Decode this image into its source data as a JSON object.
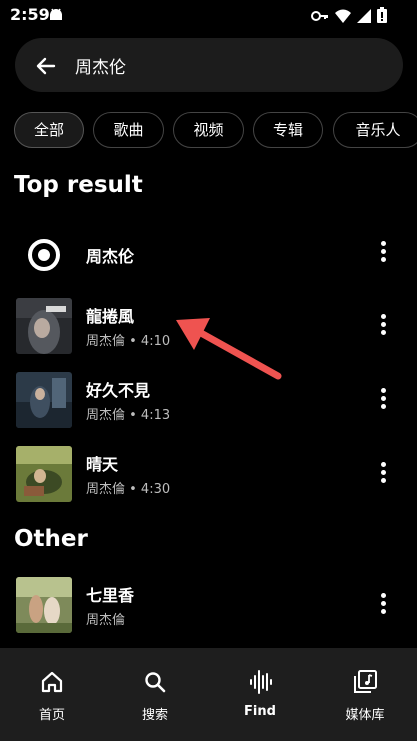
{
  "status_bar": {
    "time": "2:59",
    "left_icon": "android-icon",
    "right_icons": [
      "key-icon",
      "wifi-icon",
      "signal-icon",
      "battery-icon"
    ]
  },
  "search": {
    "query": "周杰伦",
    "back_icon": "arrow-left-icon"
  },
  "chips": [
    "全部",
    "歌曲",
    "视频",
    "专辑",
    "音乐人"
  ],
  "top_result": {
    "heading": "Top result",
    "artist": {
      "name": "周杰伦",
      "icon": "artist-target-icon"
    },
    "songs": [
      {
        "title": "龍捲風",
        "subtitle": "周杰倫 • 4:10"
      },
      {
        "title": "好久不見",
        "subtitle": "周杰倫 • 4:13"
      },
      {
        "title": "晴天",
        "subtitle": "周杰倫 • 4:30"
      }
    ]
  },
  "other": {
    "heading": "Other",
    "songs": [
      {
        "title": "七里香",
        "subtitle": "周杰倫"
      }
    ]
  },
  "annotation": {
    "type": "red-arrow",
    "color": "#ef5350"
  },
  "bottom_nav": [
    {
      "label": "首页",
      "icon": "home-icon",
      "active": false
    },
    {
      "label": "搜索",
      "icon": "search-icon",
      "active": false
    },
    {
      "label": "Find",
      "icon": "waveform-icon",
      "active": true
    },
    {
      "label": "媒体库",
      "icon": "library-icon",
      "active": false
    }
  ],
  "colors": {
    "background": "#000000",
    "surface": "#1c1c1c",
    "nav": "#1e1e1e",
    "arrow": "#ef5350"
  }
}
